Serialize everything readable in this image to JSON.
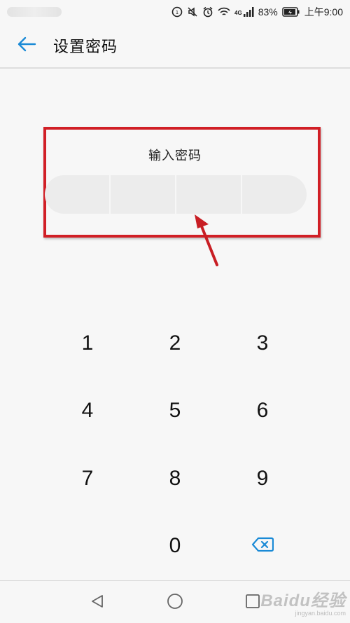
{
  "status_bar": {
    "network_label": "4G",
    "battery_percent": "83%",
    "time": "上午9:00"
  },
  "header": {
    "title": "设置密码"
  },
  "pin_entry": {
    "prompt": "输入密码",
    "digit_count": 4
  },
  "keypad": {
    "keys": [
      "1",
      "2",
      "3",
      "4",
      "5",
      "6",
      "7",
      "8",
      "9",
      "0"
    ]
  },
  "watermark": {
    "brand": "Baidu经验",
    "url": "jingyan.baidu.com"
  },
  "colors": {
    "accent": "#1a8ad6",
    "highlight_box": "#d11f26",
    "background": "#f7f7f7",
    "pin_field": "#ececec"
  }
}
